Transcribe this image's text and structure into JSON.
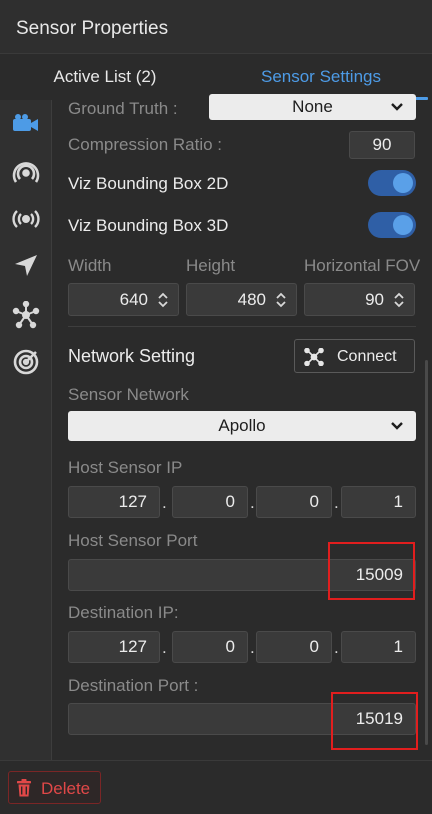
{
  "window": {
    "title": "Sensor Properties"
  },
  "tabs": {
    "active_list": "Active List  (2)",
    "sensor_settings": "Sensor Settings"
  },
  "sidebar": {
    "icons": [
      "camera-icon",
      "radar-icon",
      "broadcast-icon",
      "navigation-icon",
      "network-icon",
      "target-icon"
    ]
  },
  "settings": {
    "ground_truth": {
      "label": "Ground Truth :",
      "value": "None"
    },
    "compression": {
      "label": "Compression Ratio :",
      "value": "90"
    },
    "bbox2d": {
      "label": "Viz Bounding Box 2D",
      "on": true
    },
    "bbox3d": {
      "label": "Viz Bounding Box 3D",
      "on": true
    },
    "width": {
      "label": "Width",
      "value": "640"
    },
    "height": {
      "label": "Height",
      "value": "480"
    },
    "fov": {
      "label": "Horizontal FOV",
      "value": "90"
    }
  },
  "network": {
    "title": "Network Setting",
    "connect_label": "Connect",
    "sensor_network": {
      "label": "Sensor Network",
      "value": "Apollo"
    },
    "host_ip": {
      "label": "Host Sensor IP",
      "octets": [
        "127",
        "0",
        "0",
        "1"
      ]
    },
    "host_port": {
      "label": "Host Sensor Port",
      "value": "15009"
    },
    "dest_ip": {
      "label": "Destination IP:",
      "octets": [
        "127",
        "0",
        "0",
        "1"
      ]
    },
    "dest_port": {
      "label": "Destination Port :",
      "value": "15019"
    },
    "dot": "."
  },
  "footer": {
    "delete_label": "Delete"
  },
  "colors": {
    "accent": "#4d9be6",
    "toggle_track": "#2f5fa6",
    "toggle_knob": "#5aa0e8",
    "danger": "#e04848",
    "highlight": "#e11e1e"
  }
}
